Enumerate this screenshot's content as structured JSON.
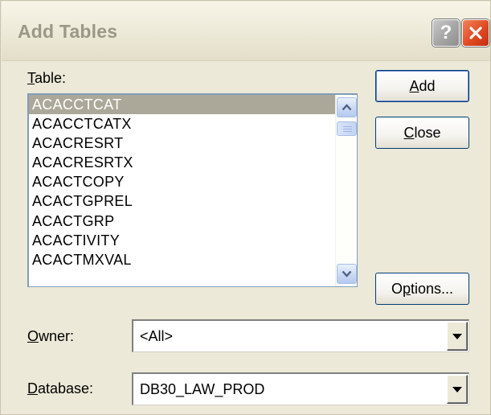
{
  "window": {
    "title": "Add Tables",
    "help_label": "?"
  },
  "table": {
    "label_mnemonic": "T",
    "label_rest": "able:",
    "items": [
      "ACACCTCAT",
      "ACACCTCATX",
      "ACACRESRT",
      "ACACRESRTX",
      "ACACTCOPY",
      "ACACTGPREL",
      "ACACTGRP",
      "ACACTIVITY",
      "ACACTMXVAL"
    ],
    "selected_index": 0
  },
  "buttons": {
    "add_mnemonic": "A",
    "add_rest": "dd",
    "close_mnemonic": "C",
    "close_rest": "lose",
    "options_pre": "O",
    "options_mnemonic": "p",
    "options_rest": "tions..."
  },
  "owner": {
    "label_mnemonic": "O",
    "label_rest": "wner:",
    "value": "<All>"
  },
  "database": {
    "label_mnemonic": "D",
    "label_rest": "atabase:",
    "value": "DB30_LAW_PROD"
  },
  "colors": {
    "dialog_bg": "#ECE9D8",
    "selection_bg": "#ACA899",
    "close_red": "#E04A22",
    "button_border": "#003C74"
  },
  "icons": {
    "help": "question-mark-icon",
    "close": "x-close-icon",
    "scroll_up": "arrow-up-icon",
    "scroll_down": "arrow-down-icon",
    "dropdown": "triangle-down-icon"
  }
}
